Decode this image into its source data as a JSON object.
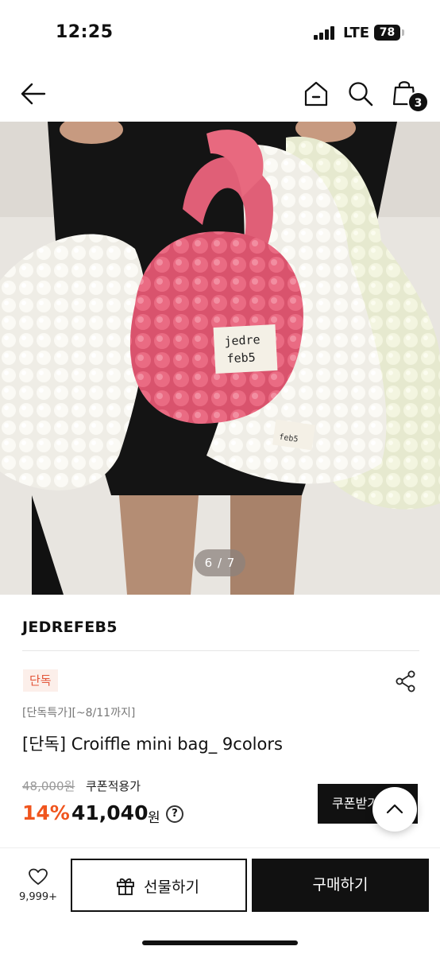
{
  "status_bar": {
    "time": "12:25",
    "network": "LTE",
    "battery": "78"
  },
  "header": {
    "cart_count": "3",
    "icons": [
      "back-arrow-icon",
      "home-icon",
      "search-icon",
      "shopping-bag-icon"
    ]
  },
  "gallery": {
    "page_indicator": "6 / 7",
    "label_lines": [
      "jedre",
      "feb5"
    ]
  },
  "product": {
    "brand": "JEDREFEB5",
    "badge": "단독",
    "sub_text": "[단독특가][~8/11까지]",
    "title": "[단독] Croiffle mini bag_ 9colors",
    "original_price": "48,000원",
    "coupon_applied_label": "쿠폰적용가",
    "discount": "14%",
    "price": "41,040",
    "currency": "원",
    "info_icon": "?",
    "coupon_button": "쿠폰받기"
  },
  "bottom_bar": {
    "like_count": "9,999+",
    "gift_label": "선물하기",
    "buy_label": "구매하기"
  },
  "colors": {
    "accent": "#f0551e",
    "badge_bg": "#fcefea",
    "badge_text": "#e3563a",
    "bag_pink": "#e8697f"
  }
}
